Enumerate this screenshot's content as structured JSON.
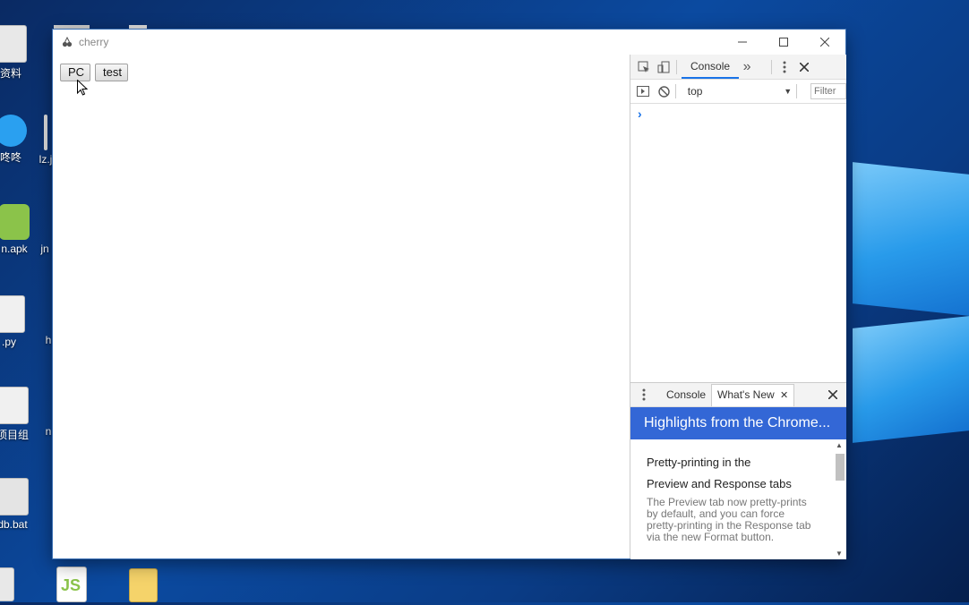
{
  "desktop": {
    "icons": [
      {
        "label": "资料"
      },
      {
        "label": "咚咚"
      },
      {
        "label": "lz.j"
      },
      {
        "label": "n.apk"
      },
      {
        "label": "jn"
      },
      {
        "label": ".py"
      },
      {
        "label": "h"
      },
      {
        "label": "项目组"
      },
      {
        "label": "n"
      },
      {
        "label": "db.bat"
      },
      {
        "label": "JS"
      }
    ]
  },
  "window": {
    "title": "cherry",
    "app_icon": "cherry-icon",
    "controls": [
      "minimize-icon",
      "maximize-icon",
      "close-icon"
    ]
  },
  "page": {
    "buttons": [
      {
        "label": "PC"
      },
      {
        "label": "test"
      }
    ]
  },
  "devtools": {
    "tabs": [
      {
        "label": "Console",
        "active": true
      }
    ],
    "overflow": "»",
    "context_select": "top",
    "filter_placeholder": "Filter",
    "prompt": "›",
    "drawer": {
      "tabs": [
        {
          "label": "Console"
        },
        {
          "label": "What's New"
        }
      ],
      "banner": "Highlights from the Chrome...",
      "feature_title": "Pretty-printing in the Preview and Response tabs",
      "feature_title_line1": "Pretty-printing in the",
      "feature_title_line2": "Preview and Response tabs",
      "feature_desc": "The Preview tab now pretty-prints by default, and you can force pretty-printing in the Response tab via the new Format button."
    },
    "accent": "#1a73e8",
    "banner_color": "#3367d6"
  }
}
